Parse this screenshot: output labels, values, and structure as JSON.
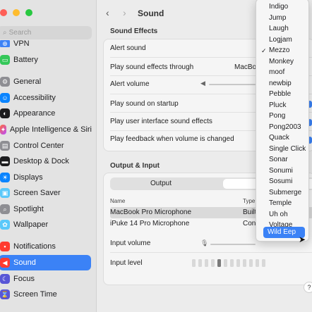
{
  "sidebar": {
    "search_placeholder": "Search",
    "items": [
      {
        "label": "VPN",
        "icon": "vpn-icon",
        "color": "#3b82f6"
      },
      {
        "label": "Battery",
        "icon": "battery-icon",
        "color": "#34c759"
      },
      {
        "label": "General",
        "icon": "gear-icon",
        "color": "#8e8e93"
      },
      {
        "label": "Accessibility",
        "icon": "accessibility-icon",
        "color": "#0a84ff"
      },
      {
        "label": "Appearance",
        "icon": "appearance-icon",
        "color": "#1c1c1e"
      },
      {
        "label": "Apple Intelligence & Siri",
        "icon": "siri-icon",
        "color": "#ff6a3d"
      },
      {
        "label": "Control Center",
        "icon": "control-center-icon",
        "color": "#8e8e93"
      },
      {
        "label": "Desktop & Dock",
        "icon": "desktop-dock-icon",
        "color": "#1c1c1e"
      },
      {
        "label": "Displays",
        "icon": "displays-icon",
        "color": "#0a84ff"
      },
      {
        "label": "Screen Saver",
        "icon": "screen-saver-icon",
        "color": "#5ac8fa"
      },
      {
        "label": "Spotlight",
        "icon": "spotlight-icon",
        "color": "#8e8e93"
      },
      {
        "label": "Wallpaper",
        "icon": "wallpaper-icon",
        "color": "#5ac8fa"
      },
      {
        "label": "Notifications",
        "icon": "notifications-icon",
        "color": "#ff3b30"
      },
      {
        "label": "Sound",
        "icon": "sound-icon",
        "color": "#ff3b30"
      },
      {
        "label": "Focus",
        "icon": "focus-icon",
        "color": "#5856d6"
      },
      {
        "label": "Screen Time",
        "icon": "screen-time-icon",
        "color": "#5856d6"
      }
    ]
  },
  "header": {
    "title": "Sound"
  },
  "sound_effects": {
    "heading": "Sound Effects",
    "alert_sound_label": "Alert sound",
    "play_through_label": "Play sound effects through",
    "play_through_value": "MacBoo",
    "alert_volume_label": "Alert volume",
    "startup_label": "Play sound on startup",
    "ui_sounds_label": "Play user interface sound effects",
    "feedback_label": "Play feedback when volume is changed"
  },
  "output_input": {
    "heading": "Output & Input",
    "tab_output": "Output",
    "tab_input": "In",
    "col_name": "Name",
    "col_type": "Type",
    "devices": [
      {
        "name": "MacBook Pro Microphone",
        "type": "Built"
      },
      {
        "name": "iPuke 14 Pro Microphone",
        "type": "Cont"
      }
    ],
    "input_volume_label": "Input volume",
    "input_level_label": "Input level",
    "input_level": 0.15
  },
  "menu": {
    "items": [
      "Indigo",
      "Jump",
      "Laugh",
      "Logjam",
      "Mezzo",
      "Monkey",
      "moof",
      "newbip",
      "Pebble",
      "Pluck",
      "Pong",
      "Pong2003",
      "Quack",
      "Single Click",
      "Sonar",
      "Sonumi",
      "Sosumi",
      "Submerge",
      "Temple",
      "Uh oh",
      "Voltage",
      "Whit",
      "Wild Eep"
    ],
    "checked": "Mezzo",
    "highlighted": "Wild Eep",
    "check_glyph": "✓"
  },
  "help_label": "?",
  "colors": {
    "accent": "#3b82f6"
  }
}
